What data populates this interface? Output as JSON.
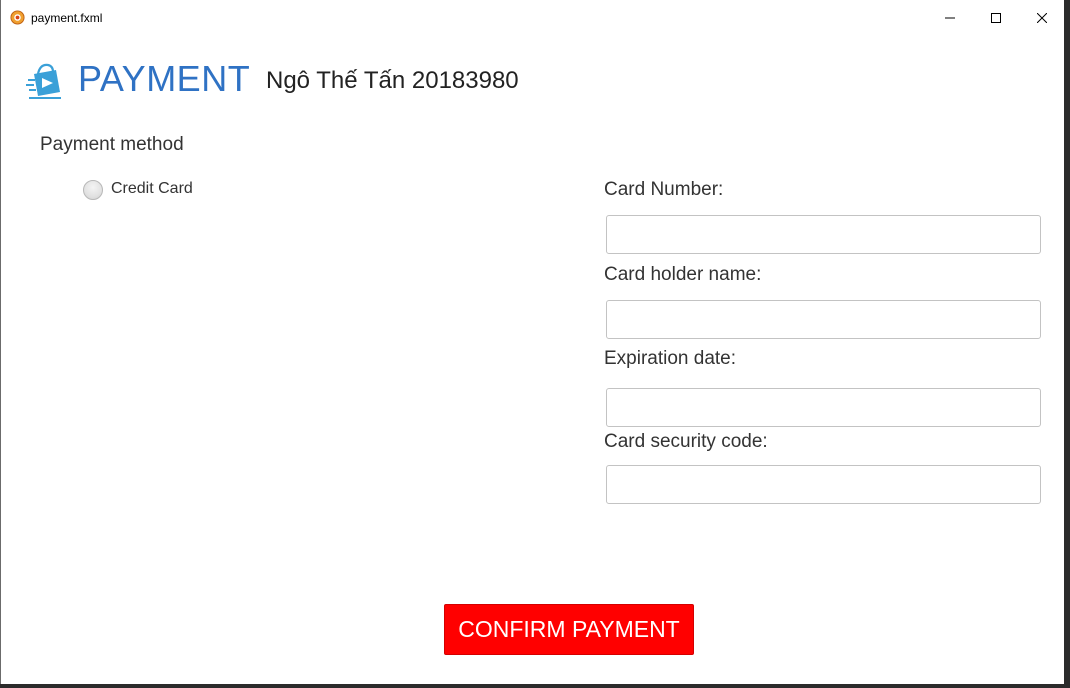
{
  "window": {
    "title": "payment.fxml"
  },
  "header": {
    "title": "PAYMENT",
    "author": "Ngô Thế Tấn 20183980",
    "logo_icon": "shopping-bag-arrow-icon"
  },
  "payment_method": {
    "label": "Payment method",
    "options": [
      {
        "label": "Credit Card",
        "selected": false
      }
    ]
  },
  "form": {
    "card_number": {
      "label": "Card Number:",
      "value": ""
    },
    "holder_name": {
      "label": "Card holder name:",
      "value": ""
    },
    "expiration": {
      "label": "Expiration date:",
      "value": ""
    },
    "security_code": {
      "label": "Card security code:",
      "value": ""
    }
  },
  "actions": {
    "confirm_label": "CONFIRM PAYMENT"
  },
  "colors": {
    "accent": "#2f72c4",
    "confirm": "#ff0000"
  }
}
